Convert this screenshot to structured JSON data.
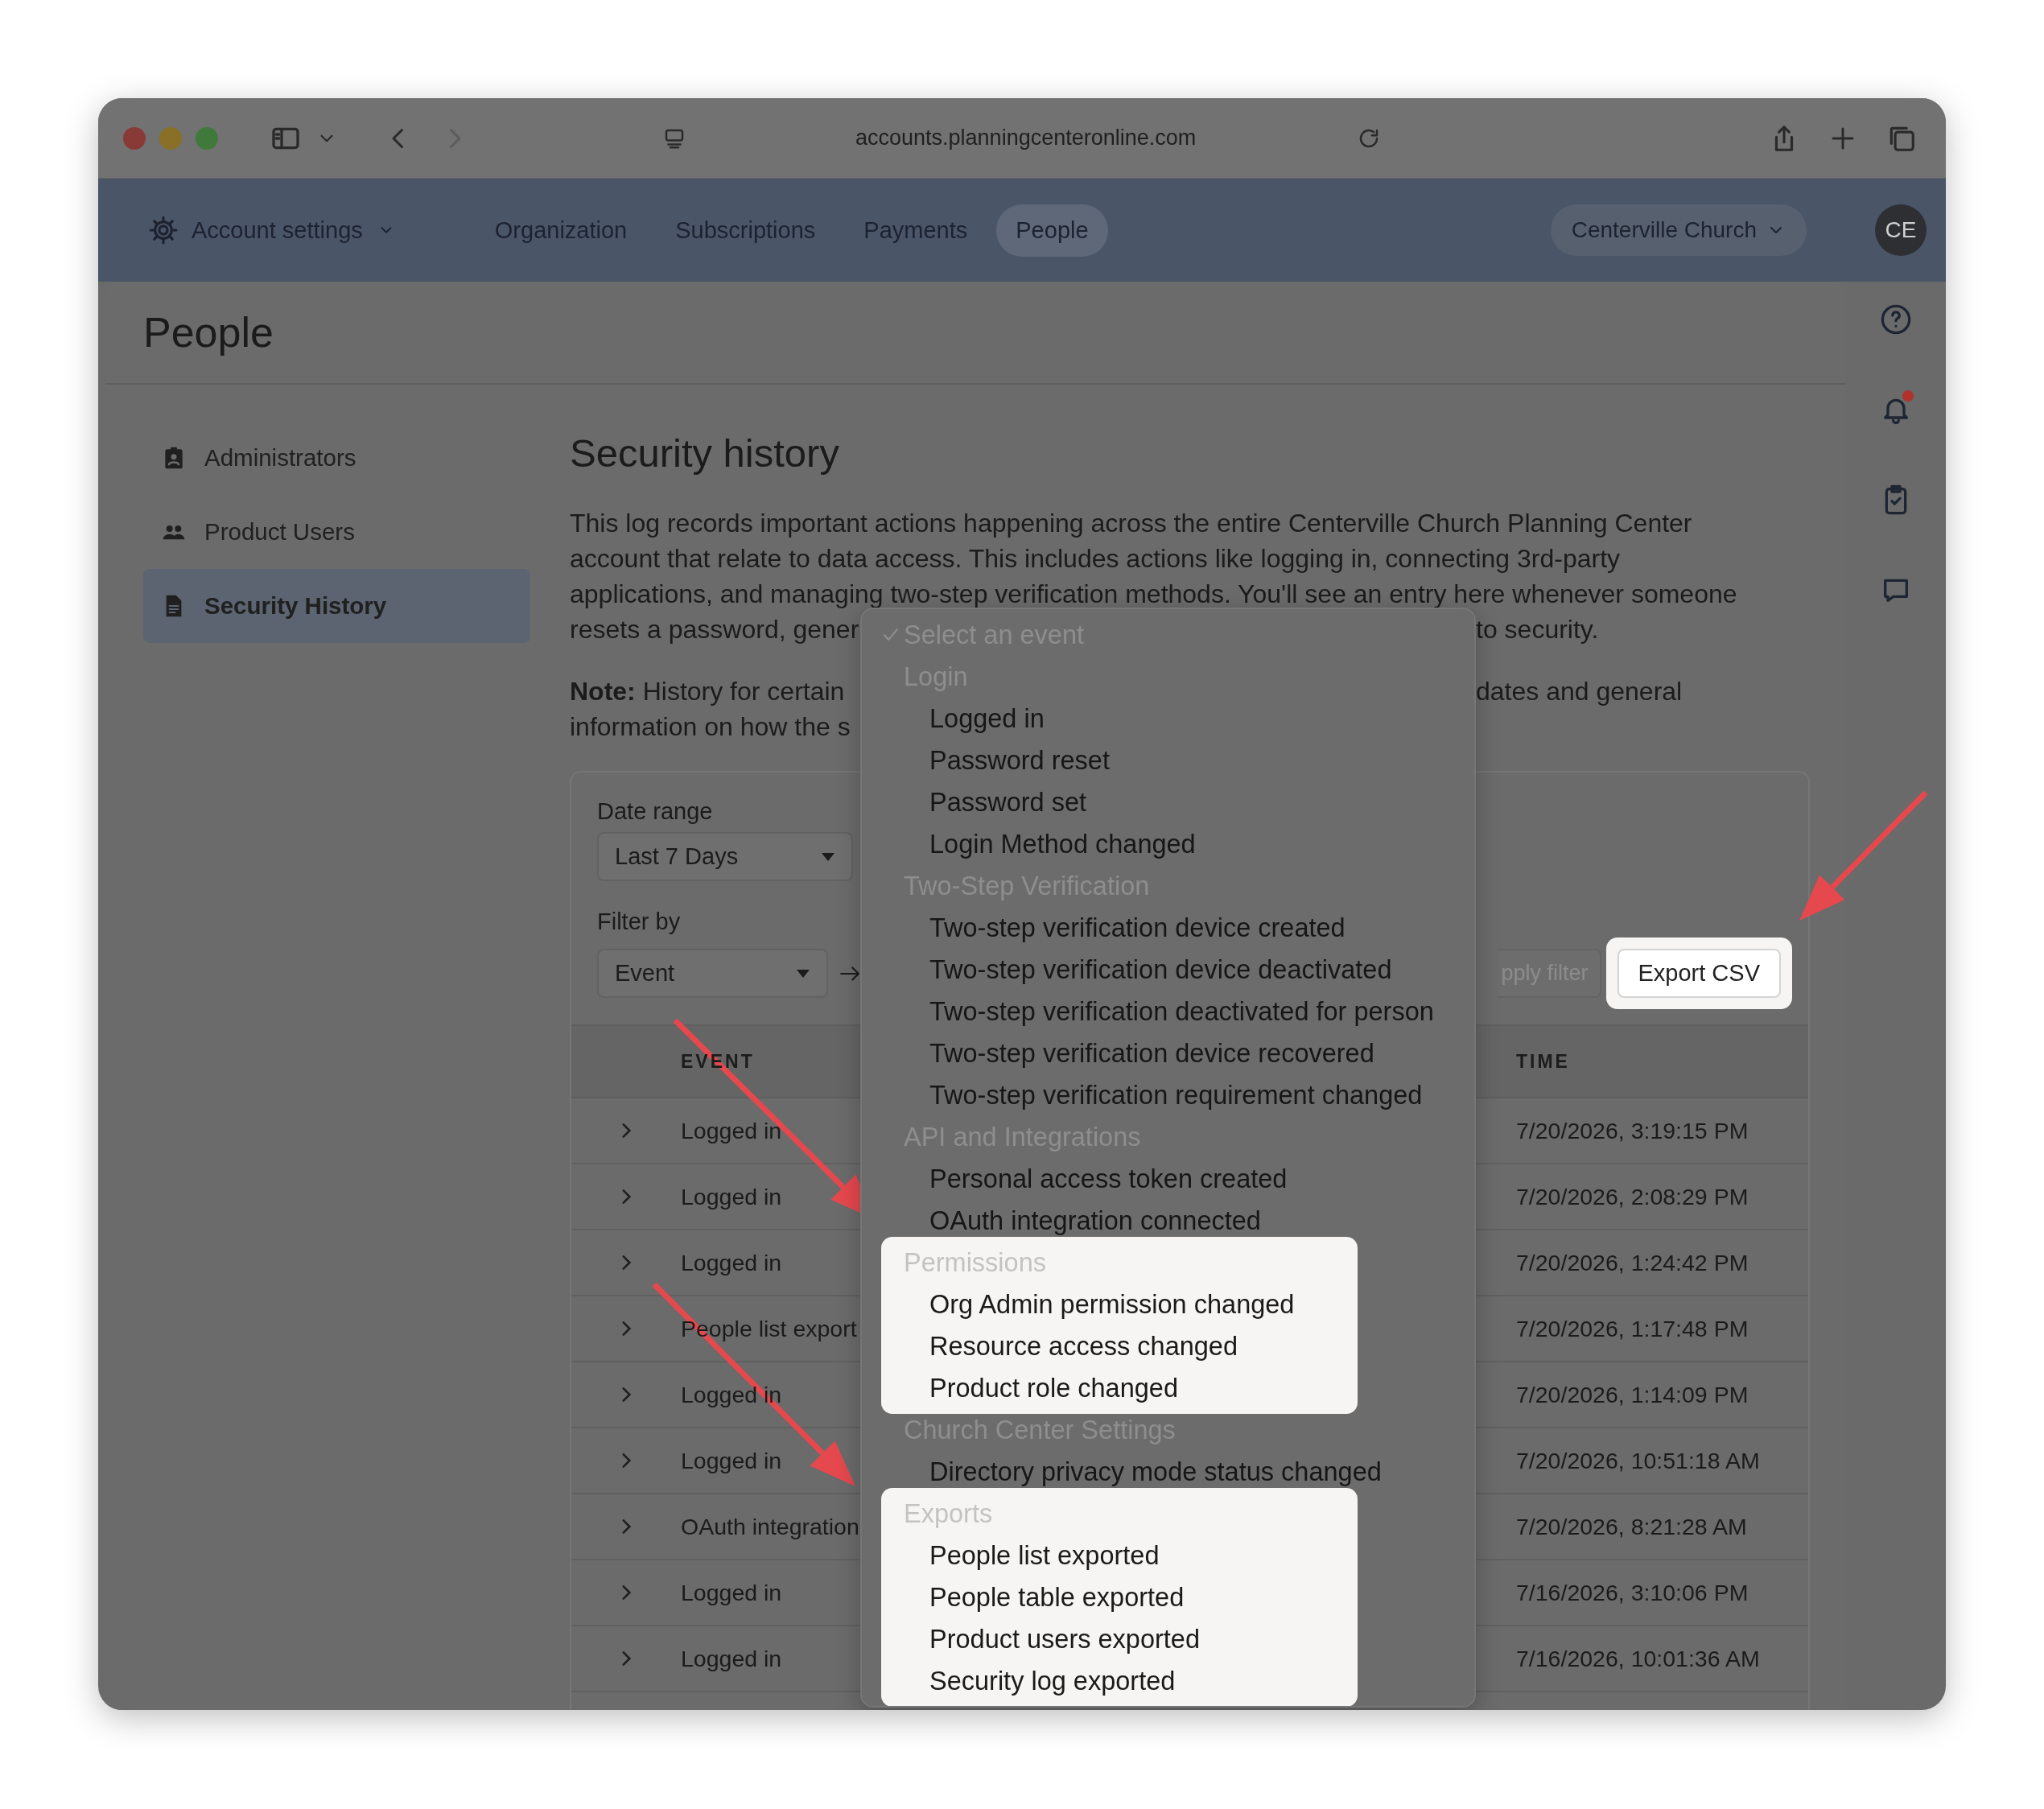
{
  "browser": {
    "url": "accounts.planningcenteronline.com",
    "forward_disabled": true
  },
  "nav": {
    "menu_label": "Account settings",
    "tabs": [
      {
        "label": "Organization",
        "selected": false
      },
      {
        "label": "Subscriptions",
        "selected": false
      },
      {
        "label": "Payments",
        "selected": false
      },
      {
        "label": "People",
        "selected": true
      }
    ],
    "org_switcher": "Centerville Church",
    "avatar": "CE"
  },
  "rail": {
    "notifications_unread": true
  },
  "page": {
    "title": "People"
  },
  "sidebar": {
    "items": [
      {
        "label": "Administrators",
        "selected": false
      },
      {
        "label": "Product Users",
        "selected": false
      },
      {
        "label": "Security History",
        "selected": true
      }
    ]
  },
  "section": {
    "title": "Security history",
    "paragraphs": [
      {
        "lines": [
          {
            "left": "This log records important actions happening across the entire Centerville Church Planning Center"
          },
          {
            "left": "account that relate to data access. This includes actions like logging in, connecting 3rd-party"
          },
          {
            "left": "applications, and managing two-step verification methods. You'll see an entry here whenever someone"
          },
          {
            "left": "resets a password, gener",
            "right": "to security."
          }
        ]
      },
      {
        "lines": [
          {
            "left": "**Note:** History for certain",
            "right": "dates and general"
          },
          {
            "left": "information on how the s"
          }
        ]
      }
    ]
  },
  "filters": {
    "date_range": {
      "label": "Date range",
      "value": "Last 7 Days"
    },
    "filter_by": {
      "label": "Filter by",
      "value": "Event"
    },
    "apply_button": {
      "label": "pply filter",
      "disabled": true
    },
    "export_button": {
      "label": "Export CSV",
      "highlighted": true
    }
  },
  "table": {
    "columns": [
      "EVENT",
      "TIME"
    ],
    "rows": [
      {
        "event": "Logged in",
        "time": "7/20/2026, 3:19:15 PM"
      },
      {
        "event": "Logged in",
        "time": "7/20/2026, 2:08:29 PM"
      },
      {
        "event": "Logged in",
        "time": "7/20/2026, 1:24:42 PM"
      },
      {
        "event": "People list export",
        "time": "7/20/2026, 1:17:48 PM"
      },
      {
        "event": "Logged in",
        "time": "7/20/2026, 1:14:09 PM"
      },
      {
        "event": "Logged in",
        "time": "7/20/2026, 10:51:18 AM"
      },
      {
        "event": "OAuth integration",
        "time": "7/20/2026, 8:21:28 AM"
      },
      {
        "event": "Logged in",
        "time": "7/16/2026, 3:10:06 PM"
      },
      {
        "event": "Logged in",
        "time": "7/16/2026, 10:01:36 AM"
      }
    ]
  },
  "dropdown": {
    "placeholder": {
      "label": "Select an event",
      "selected": true
    },
    "groups": [
      {
        "label": "Login",
        "highlighted": false,
        "items": [
          "Logged in",
          "Password reset",
          "Password set",
          "Login Method changed"
        ]
      },
      {
        "label": "Two-Step Verification",
        "highlighted": false,
        "items": [
          "Two-step verification device created",
          "Two-step verification device deactivated",
          "Two-step verification deactivated for person",
          "Two-step verification device recovered",
          "Two-step verification requirement changed"
        ]
      },
      {
        "label": "API and Integrations",
        "highlighted": false,
        "items": [
          "Personal access token created",
          "OAuth integration connected"
        ]
      },
      {
        "label": "Permissions",
        "highlighted": true,
        "items": [
          "Org Admin permission changed",
          "Resource access changed",
          "Product role changed"
        ]
      },
      {
        "label": "Church Center Settings",
        "highlighted": false,
        "items": [
          "Directory privacy mode status changed"
        ]
      },
      {
        "label": "Exports",
        "highlighted": true,
        "items": [
          "People list exported",
          "People table exported",
          "Product users exported",
          "Security log exported"
        ]
      }
    ]
  }
}
